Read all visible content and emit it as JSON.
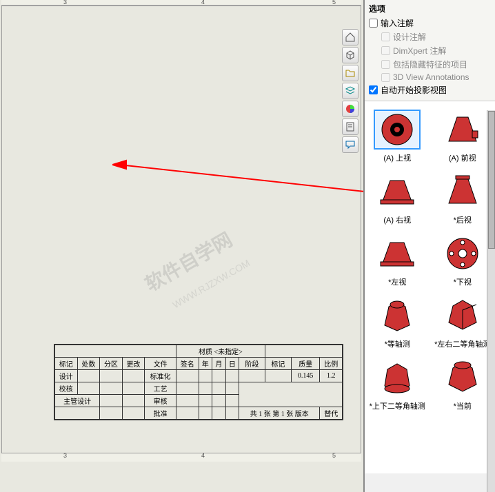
{
  "ruler": {
    "marks": [
      "3",
      "4",
      "5"
    ]
  },
  "options": {
    "title": "选项",
    "import_annotations": "输入注解",
    "design_annotations": "设计注解",
    "dimxpert": "DimXpert 注解",
    "include_hidden": "包括隐藏特征的项目",
    "view_3d": "3D View Annotations",
    "auto_proj": "自动开始投影视图"
  },
  "views": [
    {
      "label": "(A) 上视",
      "selected": true,
      "type": "top"
    },
    {
      "label": "(A) 前视",
      "selected": false,
      "type": "front"
    },
    {
      "label": "(A) 右视",
      "selected": false,
      "type": "right"
    },
    {
      "label": "*后视",
      "selected": false,
      "type": "back"
    },
    {
      "label": "*左视",
      "selected": false,
      "type": "left"
    },
    {
      "label": "*下视",
      "selected": false,
      "type": "bottom"
    },
    {
      "label": "*等轴测",
      "selected": false,
      "type": "iso1"
    },
    {
      "label": "*左右二等角轴测",
      "selected": false,
      "type": "iso2"
    },
    {
      "label": "*上下二等角轴测",
      "selected": false,
      "type": "iso3"
    },
    {
      "label": "*当前",
      "selected": false,
      "type": "current"
    }
  ],
  "title_block": {
    "material": "材质 <未指定>",
    "row_headers1": [
      "标记",
      "处数",
      "分区",
      "更改",
      "文件",
      "签名",
      "年",
      "月",
      "日"
    ],
    "row_headers2": [
      "阶段",
      "标记",
      "质量",
      "比例"
    ],
    "vals": {
      "mass": "0.145",
      "scale": "1.2"
    },
    "rows": [
      [
        "设计",
        "",
        "",
        "",
        "标准化",
        "",
        "",
        ""
      ],
      [
        "校核",
        "",
        "",
        "",
        "工艺",
        "",
        "",
        ""
      ],
      [
        "主管设计",
        "",
        "",
        "",
        "审核",
        "",
        "",
        ""
      ],
      [
        "",
        "",
        "",
        "",
        "批准",
        "",
        "",
        ""
      ]
    ],
    "sheet": "共 1 张 第 1 张 版本",
    "replace": "替代"
  },
  "watermark": {
    "main": "软件自学网",
    "sub": "WWW.RJZXW.COM"
  }
}
